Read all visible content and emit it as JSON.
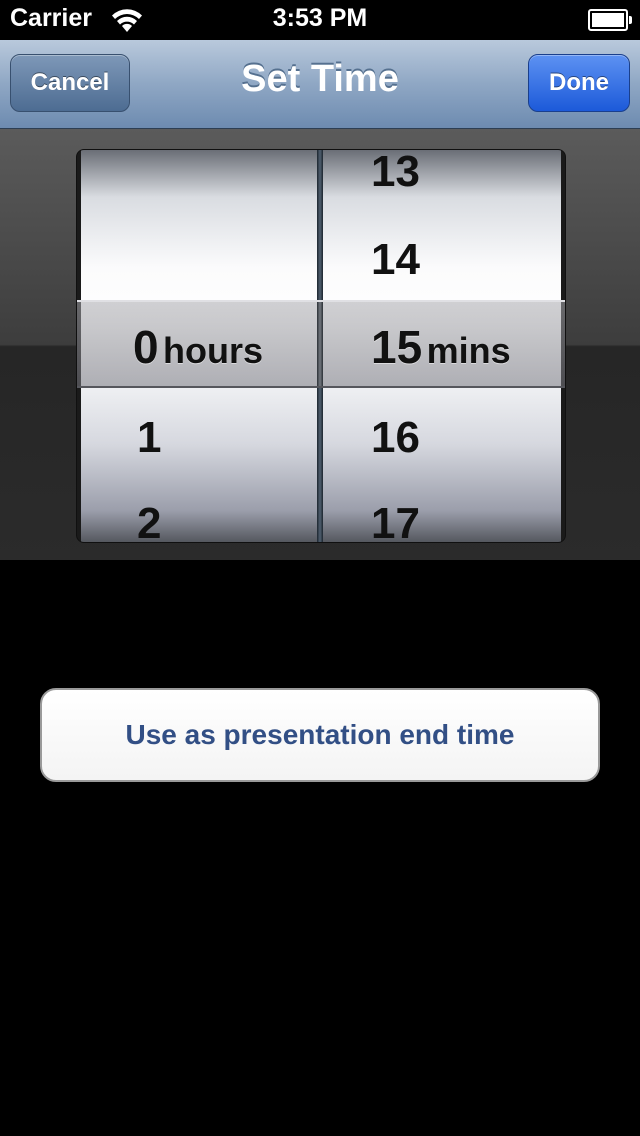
{
  "status_bar": {
    "carrier": "Carrier",
    "time": "3:53 PM"
  },
  "nav": {
    "title": "Set Time",
    "cancel_label": "Cancel",
    "done_label": "Done"
  },
  "picker": {
    "hours": {
      "above": [
        "",
        ""
      ],
      "selected": "0",
      "unit": "hours",
      "below": [
        "1",
        "2"
      ]
    },
    "minutes": {
      "above": [
        "13",
        "14"
      ],
      "selected": "15",
      "unit": "mins",
      "below": [
        "16",
        "17"
      ]
    }
  },
  "action": {
    "end_time_label": "Use as presentation end time"
  },
  "colors": {
    "nav_bar": "#8fa7c4",
    "done_button": "#1c5ad9",
    "action_text": "#324f85"
  }
}
